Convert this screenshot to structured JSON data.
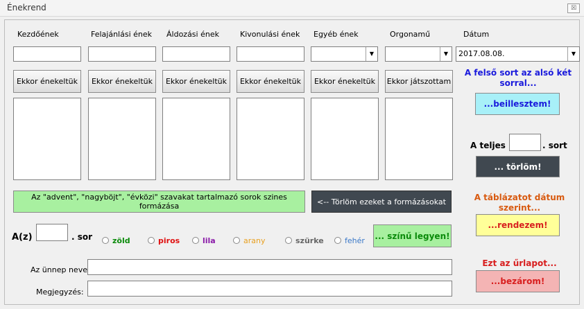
{
  "window": {
    "title": "Énekrend",
    "close_label": "☒"
  },
  "columns": [
    {
      "header": "Kezdőének",
      "button": "Ekkor énekeltük"
    },
    {
      "header": "Felajánlási ének",
      "button": "Ekkor énekeltük"
    },
    {
      "header": "Áldozási ének",
      "button": "Ekkor énekeltük"
    },
    {
      "header": "Kivonulási ének",
      "button": "Ekkor énekeltük"
    },
    {
      "header": "Egyéb ének",
      "button": "Ekkor énekeltük"
    },
    {
      "header": "Orgonamű",
      "button": "Ekkor játszottam"
    }
  ],
  "date": {
    "header": "Dátum",
    "value": "2017.08.08."
  },
  "insert": {
    "text": "A felső sort az alsó két sorral...",
    "button": "...beillesztem!"
  },
  "delete_row": {
    "prefix": "A teljes",
    "suffix": ". sort",
    "button": "... törlöm!"
  },
  "format_button": "Az \"advent\", \"nagyböjt\", \"évközi\" szavakat tartalmazó sorok szines formázása",
  "clear_format_button": "<--   Törlöm ezeket a formázásokat",
  "sort": {
    "text": "A táblázatot dátum szerint...",
    "button": "...rendezem!"
  },
  "color_row": {
    "prefix": "A(z)",
    "suffix": ". sor",
    "options": [
      {
        "label": "zöld",
        "color": "#0a8a0a"
      },
      {
        "label": "piros",
        "color": "#e01010"
      },
      {
        "label": "lila",
        "color": "#8a1aa8"
      },
      {
        "label": "arany",
        "color": "#e8a020"
      },
      {
        "label": "szürke",
        "color": "#666666"
      },
      {
        "label": "fehér",
        "color": "#3a78c8"
      }
    ],
    "button": "... színű legyen!"
  },
  "close_form": {
    "text": "Ezt az űrlapot...",
    "button": "...bezárom!"
  },
  "fields": {
    "feast_label": "Az ünnep neve:",
    "note_label": "Megjegyzés:"
  },
  "colors": {
    "insert_btn": "#a8f0f8",
    "dark_btn": "#404850",
    "sort_btn": "#ffff99",
    "close_btn": "#f4b4b4",
    "green_btn": "#a8f0a0"
  }
}
